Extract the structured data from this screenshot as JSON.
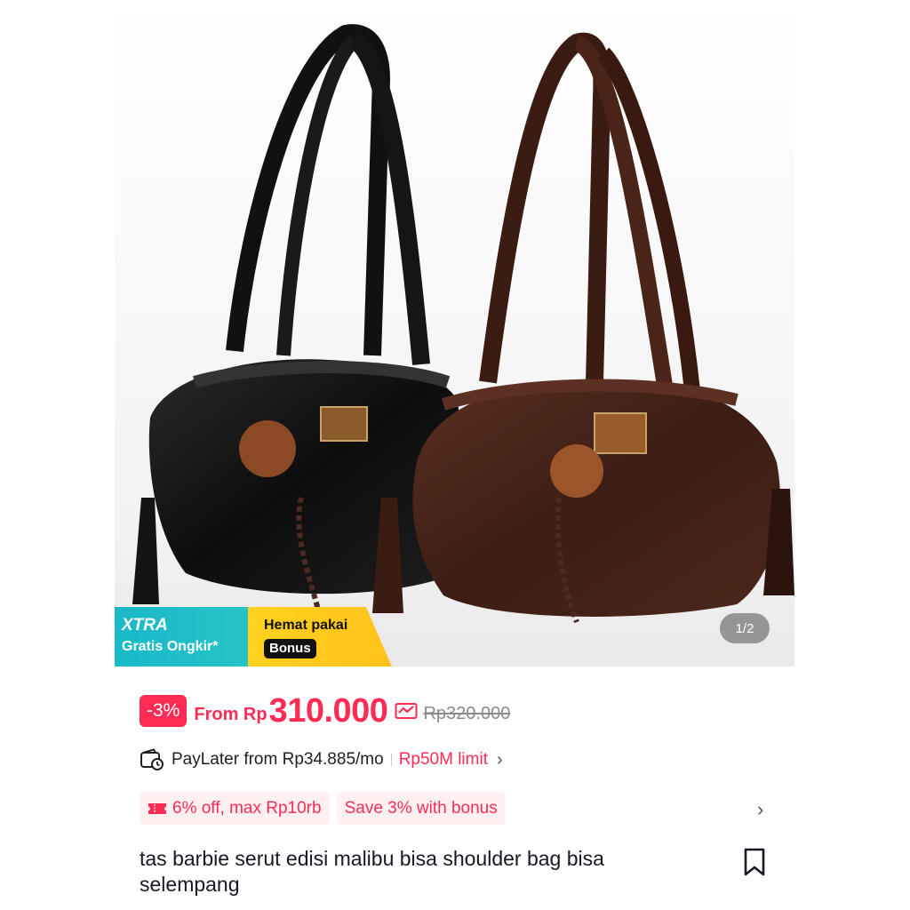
{
  "gallery": {
    "counter": "1/2",
    "promo": {
      "xtra_title": "XTRA",
      "xtra_sub": "Gratis Ongkir*",
      "hemat_title": "Hemat pakai",
      "hemat_badge": "Bonus"
    }
  },
  "price": {
    "discount": "-3%",
    "from_label": "From Rp",
    "current": "310.000",
    "original": "Rp320.000"
  },
  "paylater": {
    "text": "PayLater from Rp34.885/mo",
    "limit": "Rp50M limit"
  },
  "vouchers": [
    {
      "label": "6% off, max Rp10rb"
    },
    {
      "label": "Save 3% with bonus"
    }
  ],
  "product": {
    "title": "tas barbie serut edisi malibu bisa shoulder bag bisa selempang"
  },
  "colors": {
    "accent": "#fe2c55",
    "xtra": "#19b9c9",
    "hemat": "#ffd21f"
  }
}
